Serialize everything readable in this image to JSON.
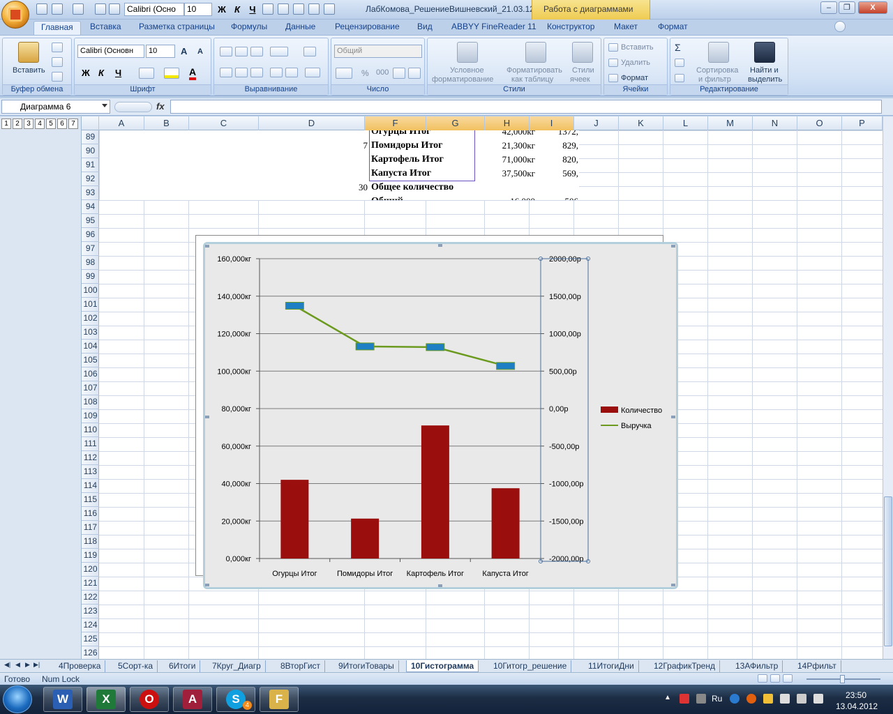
{
  "window": {
    "title": "ЛабКомова_РешениеВишневский_21.03.12",
    "context_tools": "Работа с диаграммами",
    "font_name": "Calibri (Осно",
    "font_size": "10",
    "bold": "Ж",
    "italic": "К",
    "underline": "Ч",
    "minimize": "–",
    "restore": "❐",
    "close": "X"
  },
  "tabs": [
    "Главная",
    "Вставка",
    "Разметка страницы",
    "Формулы",
    "Данные",
    "Рецензирование",
    "Вид",
    "ABBYY FineReader 11",
    "Конструктор",
    "Макет",
    "Формат"
  ],
  "ribbon": {
    "clipboard": {
      "paste": "Вставить",
      "label": "Буфер обмена"
    },
    "font": {
      "name": "Calibri (Основн",
      "size": "10",
      "grow": "A",
      "shrink": "A",
      "bold": "Ж",
      "italic": "К",
      "underline": "Ч",
      "font_color": "A",
      "label": "Шрифт"
    },
    "alignment": {
      "label": "Выравнивание"
    },
    "number": {
      "format": "Общий",
      "percent": "%",
      "thousands": "000",
      "label": "Число"
    },
    "styles": {
      "conditional": [
        "Условное",
        "форматирование"
      ],
      "table": [
        "Форматировать",
        "как таблицу"
      ],
      "cell_styles": [
        "Стили",
        "ячеек"
      ],
      "label": "Стили"
    },
    "cells": {
      "insert": "Вставить",
      "delete": "Удалить",
      "format": "Формат",
      "label": "Ячейки"
    },
    "editing": {
      "sum": "Σ",
      "sort": [
        "Сортировка",
        "и фильтр"
      ],
      "find": [
        "Найти и",
        "выделить"
      ],
      "label": "Редактирование"
    }
  },
  "formula_bar": {
    "name_box": "Диаграмма 6",
    "fx": "fx",
    "value": ""
  },
  "outline_levels": [
    "1",
    "2",
    "3",
    "4",
    "5",
    "6",
    "7"
  ],
  "columns": [
    "A",
    "B",
    "C",
    "D",
    "F",
    "G",
    "H",
    "I",
    "J",
    "K",
    "L",
    "M",
    "N",
    "O",
    "P"
  ],
  "rows": [
    "89",
    "90",
    "91",
    "92",
    "93",
    "94",
    "95",
    "96",
    "97",
    "98",
    "99",
    "100",
    "101",
    "102",
    "103",
    "104",
    "105",
    "106",
    "107",
    "108",
    "109",
    "110",
    "111",
    "112",
    "113",
    "114",
    "115",
    "116",
    "117",
    "118",
    "119",
    "120",
    "121",
    "122",
    "123",
    "124",
    "125",
    "126"
  ],
  "pivot": {
    "rows": [
      {
        "left": "",
        "name": "Огурцы Итог",
        "qty": "42,000кг",
        "rev": "1372,"
      },
      {
        "left": "7",
        "name": "Помидоры Итог",
        "qty": "21,300кг",
        "rev": "829,"
      },
      {
        "left": "",
        "name": "Картофель Итог",
        "qty": "71,000кг",
        "rev": "820,"
      },
      {
        "left": "",
        "name": "Капуста Итог",
        "qty": "37,500кг",
        "rev": "569,"
      },
      {
        "left": "30",
        "name": "Общее количество",
        "qty": "",
        "rev": ""
      },
      {
        "left": "",
        "name": "Общий",
        "qty": "16,000",
        "rev": "506"
      }
    ]
  },
  "chart_data": {
    "type": "bar",
    "categories": [
      "Огурцы Итог",
      "Помидоры Итог",
      "Картофель Итог",
      "Капуста Итог"
    ],
    "series": [
      {
        "name": "Количество",
        "type": "bar",
        "axis": "left",
        "values": [
          42,
          21.3,
          71,
          37.5
        ],
        "color": "#9b0e0e"
      },
      {
        "name": "Выручка",
        "type": "line",
        "axis": "right",
        "values": [
          1372,
          829,
          820,
          569
        ],
        "color": "#6b9a1f",
        "marker_color": "#1f7fc4"
      }
    ],
    "y_left": {
      "min": 0,
      "max": 160,
      "ticks": [
        "0,000кг",
        "20,000кг",
        "40,000кг",
        "60,000кг",
        "80,000кг",
        "100,000кг",
        "120,000кг",
        "140,000кг",
        "160,000кг"
      ]
    },
    "y_right": {
      "min": -2000,
      "max": 2000,
      "ticks": [
        "-2000,00р",
        "-1500,00р",
        "-1000,00р",
        "-500,00р",
        "0,00р",
        "500,00р",
        "1000,00р",
        "1500,00р",
        "2000,00р"
      ]
    },
    "legend_position": "right",
    "grid": true,
    "title": ""
  },
  "sheet_tabs": [
    "4Проверка",
    "5Сорт-ка",
    "6Итоги",
    "7Круг_Диагр",
    "8ВторГист",
    "9ИтогиТовары",
    "10Гистограмма",
    "10Гитогр_решение",
    "11ИтогиДни",
    "12ГрафикТренд",
    "13АФильтр",
    "14Рфильт"
  ],
  "active_sheet": "10Гистограмма",
  "status": {
    "ready": "Готово",
    "numlock": "Num Lock"
  },
  "taskbar": {
    "apps": [
      "W",
      "X",
      "O",
      "A",
      "S",
      "F"
    ],
    "lang": "Ru",
    "time": "23:50",
    "date": "13.04.2012",
    "skype_badge": "4"
  },
  "colors": {
    "accent": "#15428b",
    "bar": "#9b0e0e",
    "line": "#6b9a1f",
    "marker": "#1f7fc4"
  }
}
